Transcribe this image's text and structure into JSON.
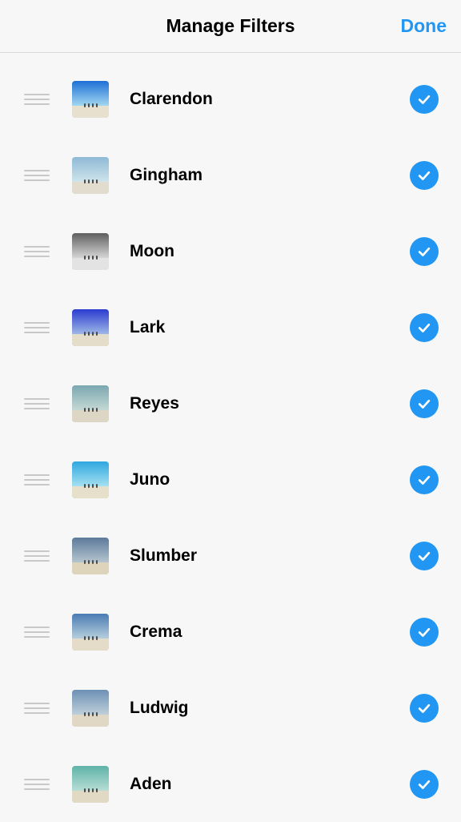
{
  "header": {
    "title": "Manage Filters",
    "done": "Done"
  },
  "accent": "#2196f3",
  "filters": [
    {
      "name": "Clarendon",
      "checked": true,
      "sky_top": "#1e6fd6",
      "sky_bottom": "#a3d8f0",
      "ground": "#e7e0ce"
    },
    {
      "name": "Gingham",
      "checked": true,
      "sky_top": "#8fb9d6",
      "sky_bottom": "#cfe4ea",
      "ground": "#e2dccf"
    },
    {
      "name": "Moon",
      "checked": true,
      "sky_top": "#5f5f5f",
      "sky_bottom": "#d7d7d7",
      "ground": "#e3e3e3"
    },
    {
      "name": "Lark",
      "checked": true,
      "sky_top": "#2a3bcf",
      "sky_bottom": "#9fb8e7",
      "ground": "#e4ddca"
    },
    {
      "name": "Reyes",
      "checked": true,
      "sky_top": "#7ba7b0",
      "sky_bottom": "#c5d9d4",
      "ground": "#ddd6c4"
    },
    {
      "name": "Juno",
      "checked": true,
      "sky_top": "#2fa7e0",
      "sky_bottom": "#a6e1f1",
      "ground": "#e6dfc9"
    },
    {
      "name": "Slumber",
      "checked": true,
      "sky_top": "#5c7a9a",
      "sky_bottom": "#b6c6cf",
      "ground": "#ded4bc"
    },
    {
      "name": "Crema",
      "checked": true,
      "sky_top": "#4a7cb3",
      "sky_bottom": "#b7cfdd",
      "ground": "#e4dcc8"
    },
    {
      "name": "Ludwig",
      "checked": true,
      "sky_top": "#6d90b5",
      "sky_bottom": "#bfd0da",
      "ground": "#e0d8c5"
    },
    {
      "name": "Aden",
      "checked": true,
      "sky_top": "#5fb3a8",
      "sky_bottom": "#b8ded5",
      "ground": "#e1d9c3"
    }
  ]
}
